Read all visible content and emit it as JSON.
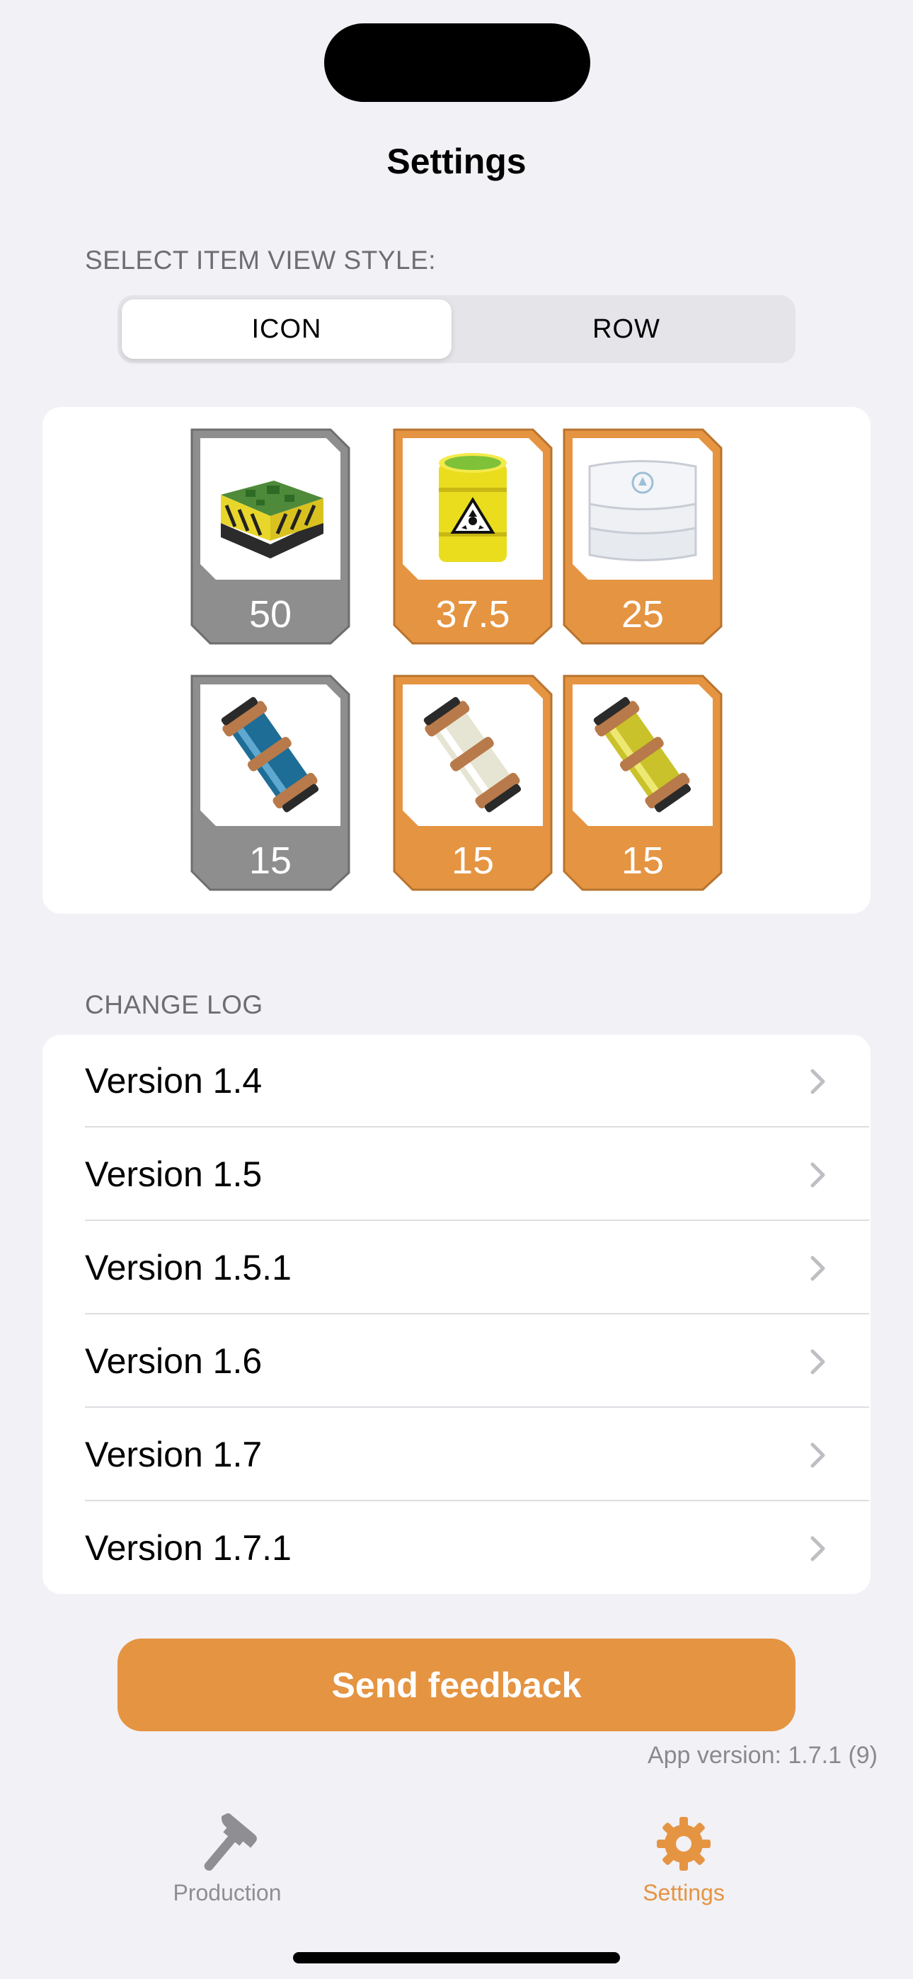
{
  "header": {
    "title": "Settings"
  },
  "view_style": {
    "label": "SELECT ITEM VIEW STYLE:",
    "options": [
      "ICON",
      "ROW"
    ],
    "selected": "ICON"
  },
  "preview_items": [
    {
      "icon": "circuit-crate-icon",
      "quantity": "50",
      "frame_color": "#8E8E8E"
    },
    {
      "icon": "radioactive-barrel-icon",
      "quantity": "37.5",
      "frame_color": "#E59442"
    },
    {
      "icon": "sack-stack-icon",
      "quantity": "25",
      "frame_color": "#E59442"
    },
    {
      "icon": "blue-canister-icon",
      "quantity": "15",
      "frame_color": "#8E8E8E"
    },
    {
      "icon": "white-canister-icon",
      "quantity": "15",
      "frame_color": "#E59442"
    },
    {
      "icon": "yellow-canister-icon",
      "quantity": "15",
      "frame_color": "#E59442"
    }
  ],
  "changelog": {
    "label": "CHANGE LOG",
    "versions": [
      "Version 1.4",
      "Version 1.5",
      "Version 1.5.1",
      "Version 1.6",
      "Version 1.7",
      "Version 1.7.1"
    ]
  },
  "feedback_button": {
    "label": "Send feedback"
  },
  "app_version": "App version: 1.7.1 (9)",
  "tab_bar": {
    "tabs": [
      {
        "label": "Production",
        "icon": "hammer-icon",
        "selected": false
      },
      {
        "label": "Settings",
        "icon": "gear-icon",
        "selected": true
      }
    ]
  },
  "colors": {
    "accent": "#E59442",
    "inactive_tab": "#8E8E93",
    "gray_frame": "#8E8E8E"
  }
}
